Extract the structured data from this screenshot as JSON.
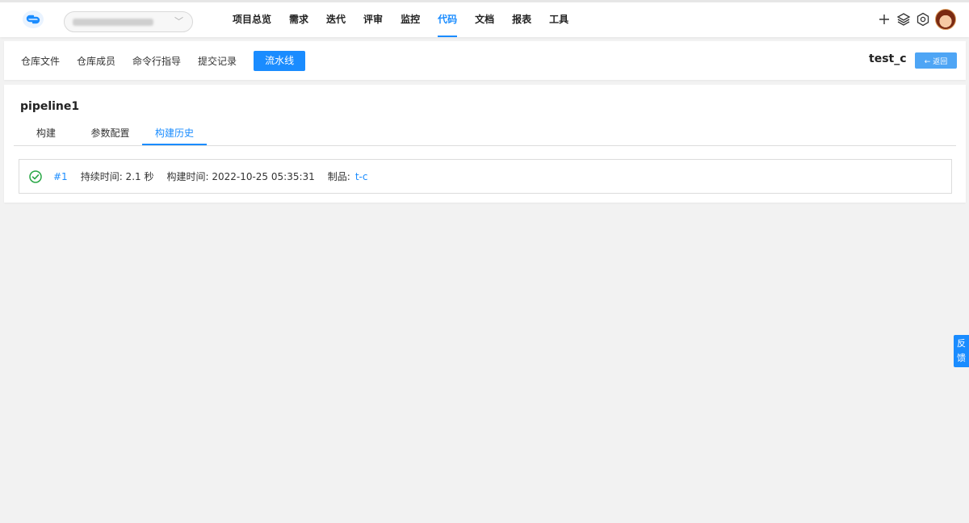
{
  "nav": {
    "items": [
      {
        "label": "项目总览",
        "active": false
      },
      {
        "label": "需求",
        "active": false
      },
      {
        "label": "迭代",
        "active": false
      },
      {
        "label": "评审",
        "active": false
      },
      {
        "label": "监控",
        "active": false
      },
      {
        "label": "代码",
        "active": true
      },
      {
        "label": "文档",
        "active": false
      },
      {
        "label": "报表",
        "active": false
      },
      {
        "label": "工具",
        "active": false
      }
    ],
    "tools": [
      "plus-icon",
      "layers-icon",
      "settings-icon",
      "avatar"
    ]
  },
  "subnav": {
    "items": [
      "仓库文件",
      "仓库成员",
      "命令行指导",
      "提交记录"
    ],
    "primary": "流水线",
    "repo_name": "test_c",
    "back_label": "← 返回"
  },
  "pipeline": {
    "title": "pipeline1",
    "tabs": [
      "构建",
      "参数配置",
      "构建历史"
    ],
    "active_tab": "构建历史",
    "history": [
      {
        "status": "success",
        "build_no": "#1",
        "duration": "持续时间: 2.1 秒",
        "build_time": "构建时间: 2022-10-25 05:35:31",
        "artifact_label": "制品:",
        "artifact": "t-c"
      }
    ]
  },
  "feedback": {
    "line1": "反",
    "line2": "馈"
  },
  "colors": {
    "accent": "#1a8cff",
    "success": "#28a745",
    "background": "#f2f2f2"
  }
}
